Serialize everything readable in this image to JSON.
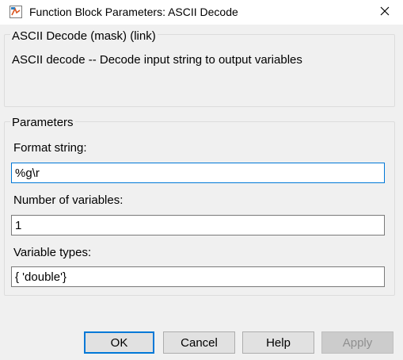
{
  "window": {
    "title": "Function Block Parameters: ASCII Decode"
  },
  "description": {
    "heading": "ASCII Decode (mask) (link)",
    "text": "ASCII decode -- Decode input string to output variables"
  },
  "parameters": {
    "heading": "Parameters",
    "fields": [
      {
        "label": "Format string:",
        "value": "%g\\r"
      },
      {
        "label": "Number of variables:",
        "value": "1"
      },
      {
        "label": "Variable types:",
        "value": "{ 'double'}"
      }
    ]
  },
  "buttons": {
    "ok": "OK",
    "cancel": "Cancel",
    "help": "Help",
    "apply": "Apply"
  },
  "colors": {
    "accent": "#0078d7",
    "background": "#f0f0f0"
  },
  "icons": {
    "window_icon": "simulink-block-icon",
    "close": "close-icon"
  }
}
